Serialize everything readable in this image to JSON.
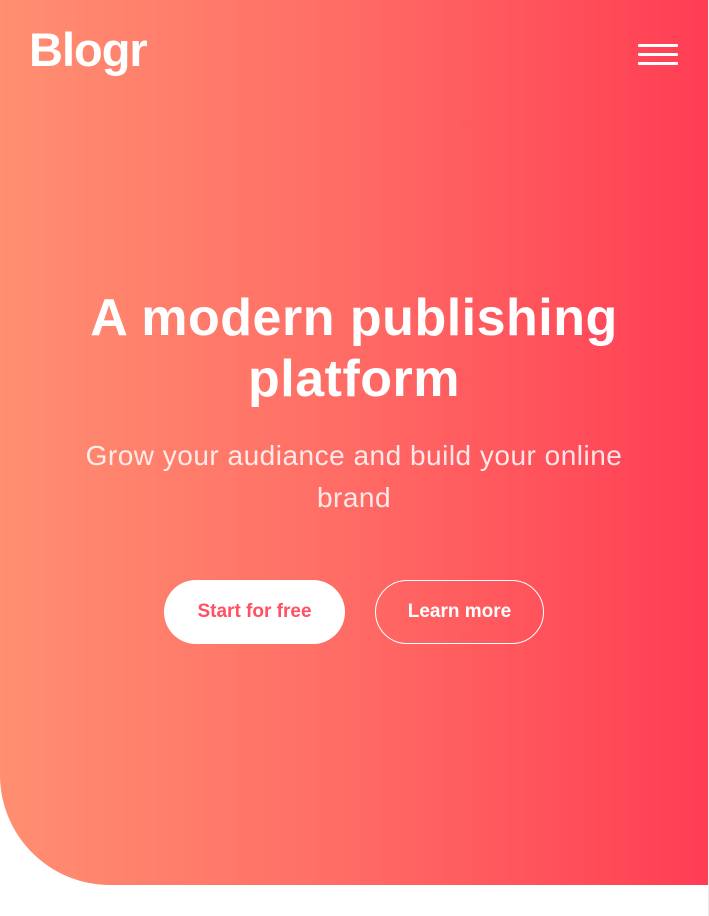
{
  "header": {
    "logo": "Blogr",
    "menu_icon": "hamburger-menu-icon"
  },
  "hero": {
    "title": "A modern publishing platform",
    "subtitle": "Grow your audiance and build your online brand",
    "primary_button": "Start for free",
    "secondary_button": "Learn more"
  },
  "colors": {
    "gradient_start": "#ff8f71",
    "gradient_end": "#ff3d54",
    "primary_button_text": "#ff5162",
    "text": "#ffffff"
  }
}
